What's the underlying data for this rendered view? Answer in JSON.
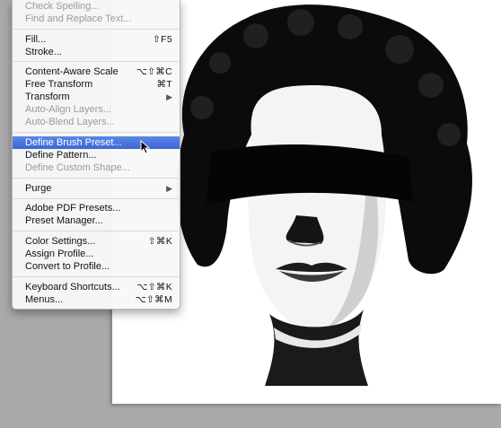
{
  "menu": {
    "items": [
      {
        "label": "Check Spelling...",
        "shortcut": "",
        "disabled": true
      },
      {
        "label": "Find and Replace Text...",
        "shortcut": "",
        "disabled": true
      },
      {
        "label": "Fill...",
        "shortcut": "⇧F5",
        "disabled": false
      },
      {
        "label": "Stroke...",
        "shortcut": "",
        "disabled": false
      },
      {
        "label": "Content-Aware Scale",
        "shortcut": "⌥⇧⌘C",
        "disabled": false
      },
      {
        "label": "Free Transform",
        "shortcut": "⌘T",
        "disabled": false
      },
      {
        "label": "Transform",
        "shortcut": "",
        "disabled": false,
        "submenu": true
      },
      {
        "label": "Auto-Align Layers...",
        "shortcut": "",
        "disabled": true
      },
      {
        "label": "Auto-Blend Layers...",
        "shortcut": "",
        "disabled": true
      },
      {
        "label": "Define Brush Preset...",
        "shortcut": "",
        "disabled": false,
        "selected": true
      },
      {
        "label": "Define Pattern...",
        "shortcut": "",
        "disabled": false
      },
      {
        "label": "Define Custom Shape...",
        "shortcut": "",
        "disabled": true
      },
      {
        "label": "Purge",
        "shortcut": "",
        "disabled": false,
        "submenu": true
      },
      {
        "label": "Adobe PDF Presets...",
        "shortcut": "",
        "disabled": false
      },
      {
        "label": "Preset Manager...",
        "shortcut": "",
        "disabled": false
      },
      {
        "label": "Color Settings...",
        "shortcut": "⇧⌘K",
        "disabled": false
      },
      {
        "label": "Assign Profile...",
        "shortcut": "",
        "disabled": false
      },
      {
        "label": "Convert to Profile...",
        "shortcut": "",
        "disabled": false
      },
      {
        "label": "Keyboard Shortcuts...",
        "shortcut": "⌥⇧⌘K",
        "disabled": false
      },
      {
        "label": "Menus...",
        "shortcut": "⌥⇧⌘M",
        "disabled": false
      }
    ],
    "submenu_arrow": "▶"
  },
  "colors": {
    "selection": "#3c66d6",
    "background": "#a9a9a9",
    "canvas": "#ffffff"
  },
  "icons": [
    "submenu-arrow-icon",
    "mouse-pointer-icon"
  ]
}
